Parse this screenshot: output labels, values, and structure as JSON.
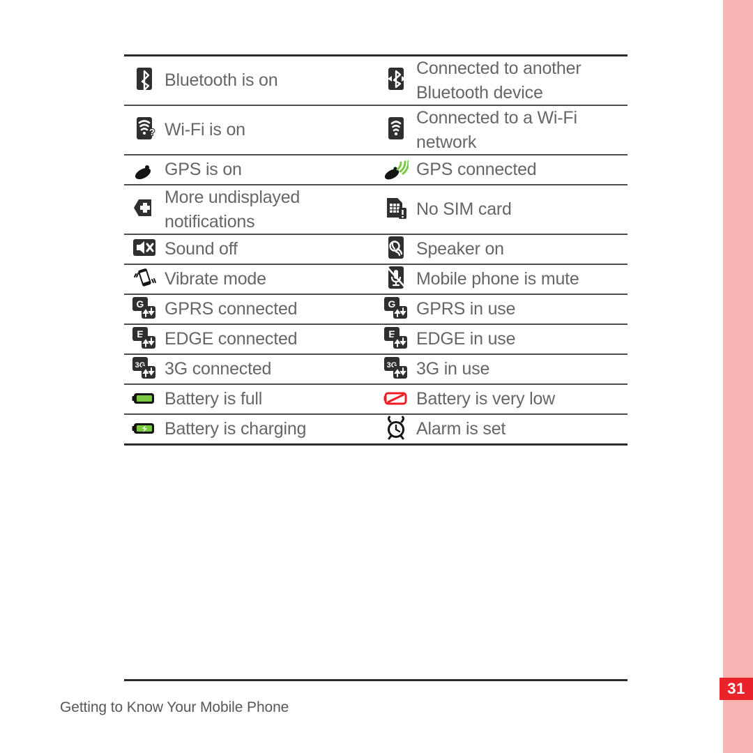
{
  "page": {
    "number": "31",
    "footer_caption": "Getting to Know Your Mobile Phone",
    "accent_red": "#e8232a",
    "edge_pink": "#f9b4b4",
    "text_gray": "#666666",
    "rule_dark": "#2b2b2b"
  },
  "table": {
    "rows": [
      {
        "left": {
          "icon": "bluetooth-on-icon",
          "label": "Bluetooth is on"
        },
        "right": {
          "icon": "bluetooth-connected-icon",
          "label": "Connected to another Bluetooth device"
        }
      },
      {
        "left": {
          "icon": "wifi-on-icon",
          "label": "Wi-Fi is on"
        },
        "right": {
          "icon": "wifi-connected-icon",
          "label": "Connected to a Wi-Fi network"
        }
      },
      {
        "left": {
          "icon": "gps-on-icon",
          "label": "GPS is on"
        },
        "right": {
          "icon": "gps-connected-icon",
          "label": "GPS connected"
        }
      },
      {
        "left": {
          "icon": "more-notifications-icon",
          "label": "More undisplayed notifications"
        },
        "right": {
          "icon": "no-sim-card-icon",
          "label": "No SIM card"
        }
      },
      {
        "left": {
          "icon": "sound-off-icon",
          "label": "Sound off"
        },
        "right": {
          "icon": "speaker-on-icon",
          "label": "Speaker on"
        }
      },
      {
        "left": {
          "icon": "vibrate-mode-icon",
          "label": "Vibrate mode"
        },
        "right": {
          "icon": "phone-mute-icon",
          "label": "Mobile phone is mute"
        }
      },
      {
        "left": {
          "icon": "gprs-connected-icon",
          "label": "GPRS connected"
        },
        "right": {
          "icon": "gprs-in-use-icon",
          "label": "GPRS in use"
        }
      },
      {
        "left": {
          "icon": "edge-connected-icon",
          "label": "EDGE connected"
        },
        "right": {
          "icon": "edge-in-use-icon",
          "label": "EDGE in use"
        }
      },
      {
        "left": {
          "icon": "3g-connected-icon",
          "label": "3G connected"
        },
        "right": {
          "icon": "3g-in-use-icon",
          "label": "3G in use"
        }
      },
      {
        "left": {
          "icon": "battery-full-icon",
          "label": "Battery is full"
        },
        "right": {
          "icon": "battery-very-low-icon",
          "label": "Battery is very low"
        }
      },
      {
        "left": {
          "icon": "battery-charging-icon",
          "label": "Battery is charging"
        },
        "right": {
          "icon": "alarm-set-icon",
          "label": "Alarm is set"
        }
      }
    ]
  }
}
